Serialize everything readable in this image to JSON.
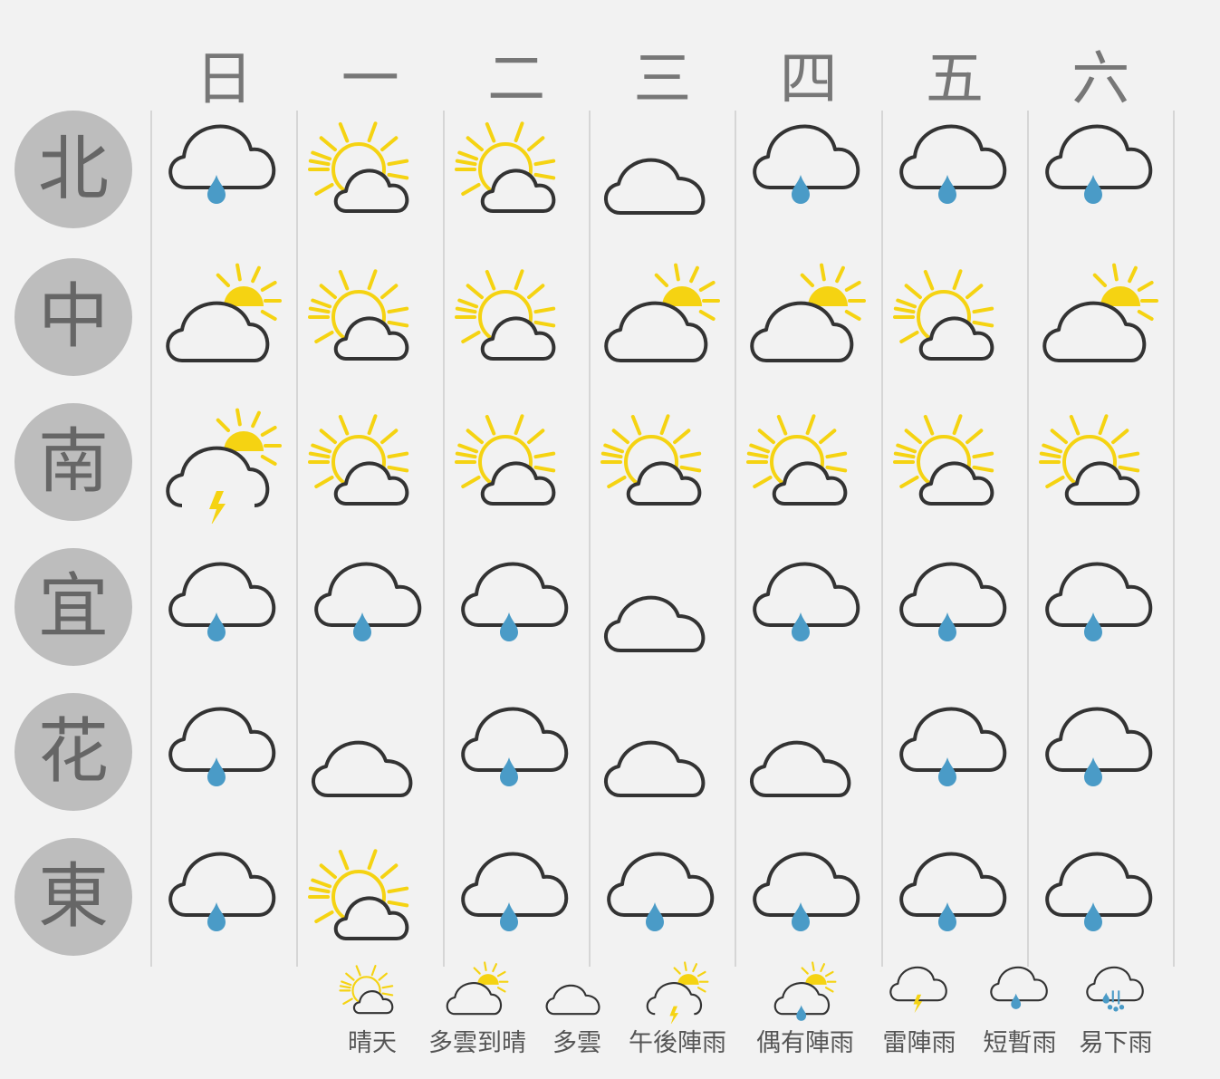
{
  "days": [
    "日",
    "一",
    "二",
    "三",
    "四",
    "五",
    "六"
  ],
  "regions": [
    "北",
    "中",
    "南",
    "宜",
    "花",
    "東"
  ],
  "grid": [
    [
      "rain",
      "sun_cloud",
      "sun_cloud",
      "cloud",
      "rain",
      "rain",
      "rain"
    ],
    [
      "cloud_sun",
      "sun_cloud",
      "sun_cloud",
      "cloud_sun",
      "cloud_sun",
      "sun_cloud",
      "cloud_sun"
    ],
    [
      "thunder_sun",
      "sun_cloud",
      "sun_cloud",
      "sun_cloud",
      "sun_cloud",
      "sun_cloud",
      "sun_cloud"
    ],
    [
      "rain",
      "rain",
      "rain",
      "cloud",
      "rain",
      "rain",
      "rain"
    ],
    [
      "rain",
      "cloud",
      "rain",
      "cloud",
      "cloud",
      "rain",
      "rain"
    ],
    [
      "rain",
      "sun_cloud",
      "rain",
      "rain",
      "rain",
      "rain",
      "rain"
    ]
  ],
  "legend": [
    {
      "icon": "sun_cloud",
      "label": "晴天"
    },
    {
      "icon": "cloud_sun",
      "label": "多雲到晴"
    },
    {
      "icon": "cloud",
      "label": "多雲"
    },
    {
      "icon": "thunder_sun",
      "label": "午後陣雨"
    },
    {
      "icon": "rain_sun",
      "label": "偶有陣雨"
    },
    {
      "icon": "thunder",
      "label": "雷陣雨"
    },
    {
      "icon": "rain",
      "label": "短暫雨"
    },
    {
      "icon": "heavy_rain",
      "label": "易下雨"
    }
  ],
  "colors": {
    "background": "#f2f2f2",
    "sun": "#f5d312",
    "cloud_stroke": "#333333",
    "rain_drop": "#4a9bc7",
    "region_circle": "#bdbdbd",
    "region_text": "#666666",
    "day_text": "#777777",
    "divider": "#d6d6d6"
  },
  "icon_names": {
    "sun_cloud": "sunny-icon",
    "cloud_sun": "cloudy-to-sunny-icon",
    "cloud": "cloudy-icon",
    "thunder_sun": "afternoon-showers-icon",
    "rain_sun": "occasional-showers-icon",
    "thunder": "thunderstorm-icon",
    "rain": "brief-rain-icon",
    "heavy_rain": "likely-rain-icon"
  }
}
